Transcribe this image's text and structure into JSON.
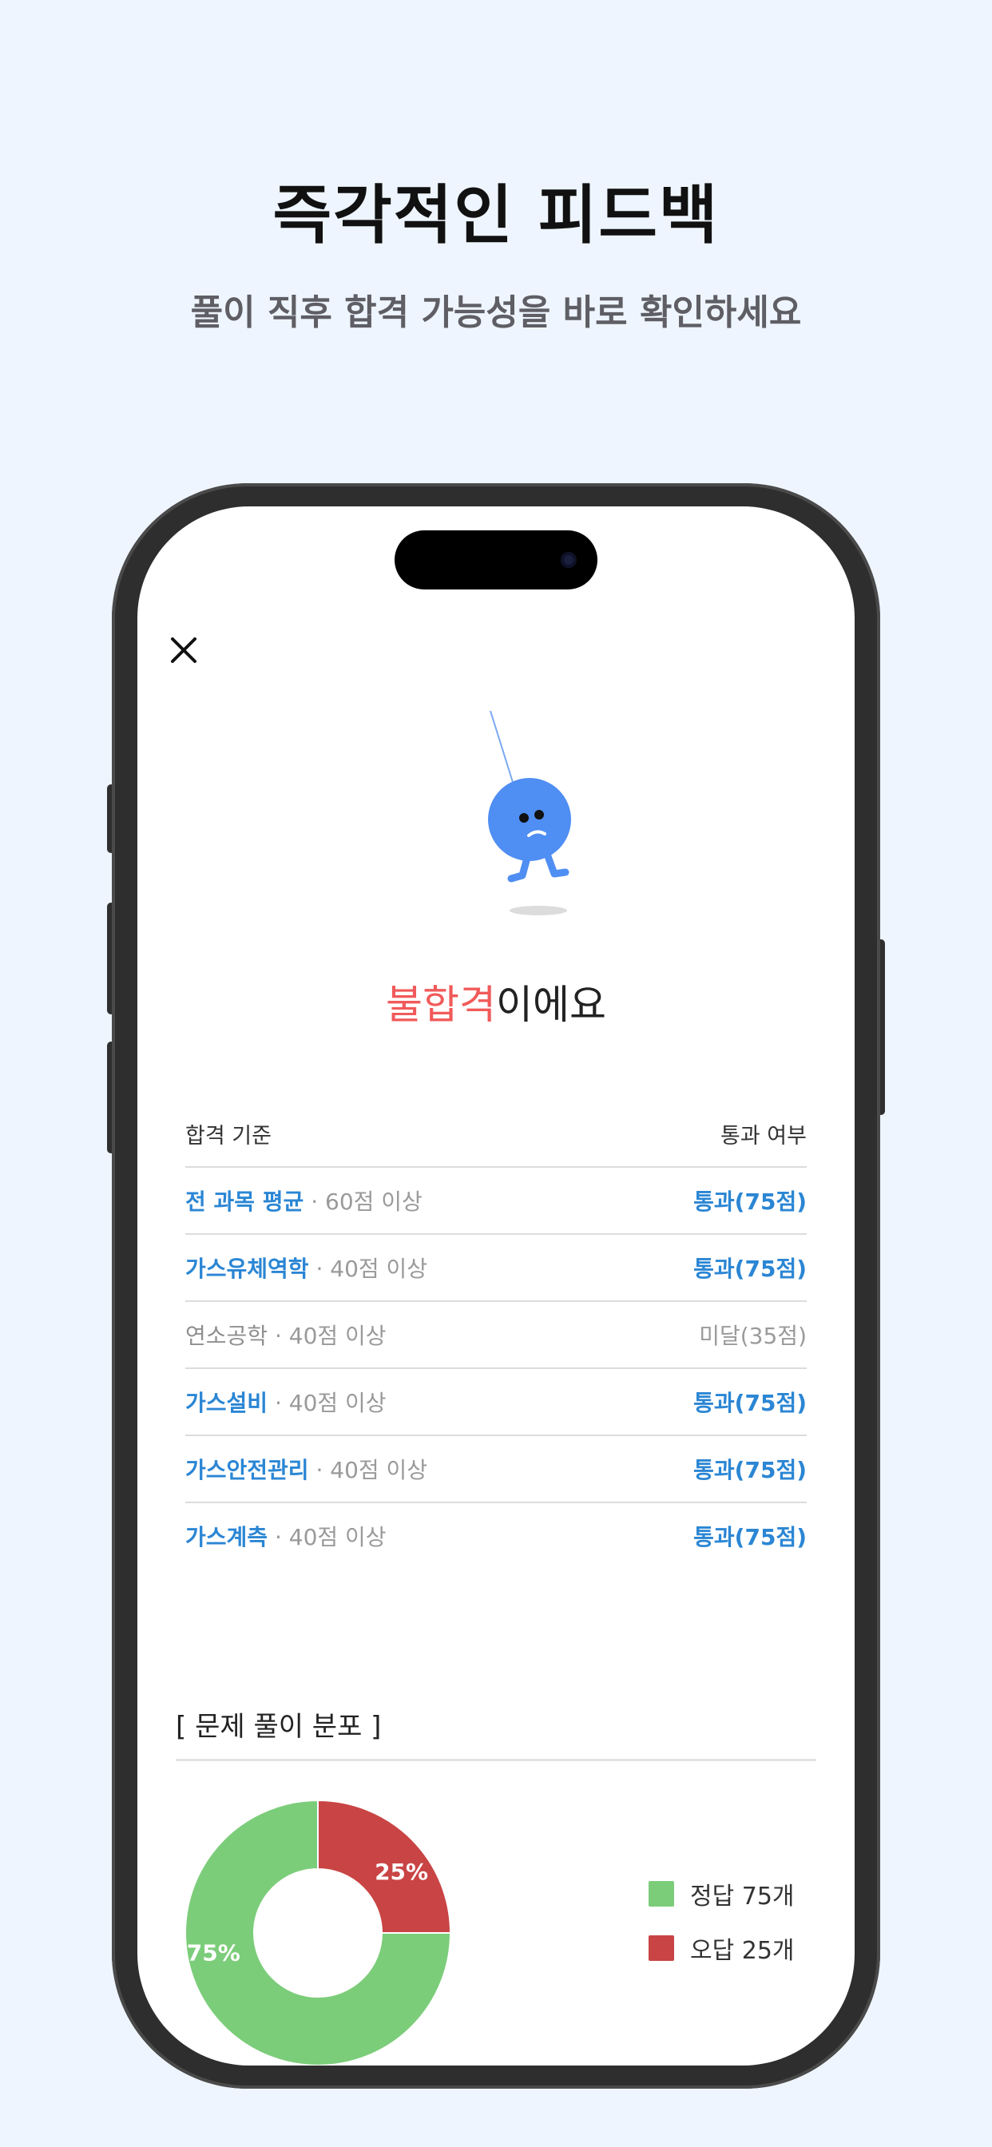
{
  "promo": {
    "title": "즉각적인 피드백",
    "subtitle": "풀이 직후 합격 가능성을 바로 확인하세요"
  },
  "result": {
    "status_highlight": "불합격",
    "status_suffix": "이에요"
  },
  "criteria": {
    "header_left": "합격 기준",
    "header_right": "통과 여부",
    "rows": [
      {
        "subject": "전 과목 평균",
        "requirement": " · 60점 이상",
        "status": "통과(75점)",
        "passed": true
      },
      {
        "subject": "가스유체역학",
        "requirement": " · 40점 이상",
        "status": "통과(75점)",
        "passed": true
      },
      {
        "subject": "연소공학",
        "requirement": " · 40점 이상",
        "status": "미달(35점)",
        "passed": false
      },
      {
        "subject": "가스설비",
        "requirement": " · 40점 이상",
        "status": "통과(75점)",
        "passed": true
      },
      {
        "subject": "가스안전관리",
        "requirement": " · 40점 이상",
        "status": "통과(75점)",
        "passed": true
      },
      {
        "subject": "가스계측",
        "requirement": " · 40점 이상",
        "status": "통과(75점)",
        "passed": true
      }
    ]
  },
  "distribution": {
    "title": "[ 문제 풀이 분포 ]",
    "correct_label": "정답 75개",
    "wrong_label": "오답 25개",
    "correct_pct_label": "75%",
    "wrong_pct_label": "25%"
  },
  "chart_data": {
    "type": "pie",
    "categories": [
      "정답",
      "오답"
    ],
    "values": [
      75,
      25
    ],
    "colors": [
      "#7ccd7a",
      "#c94444"
    ]
  },
  "colors": {
    "background": "#eef5fe",
    "pass_blue": "#2b86d4",
    "fail_red": "#f15a5a",
    "mascot_blue": "#4f8ef2"
  },
  "icons": {
    "close": "close-icon",
    "mascot": "sad-balloon-mascot"
  }
}
